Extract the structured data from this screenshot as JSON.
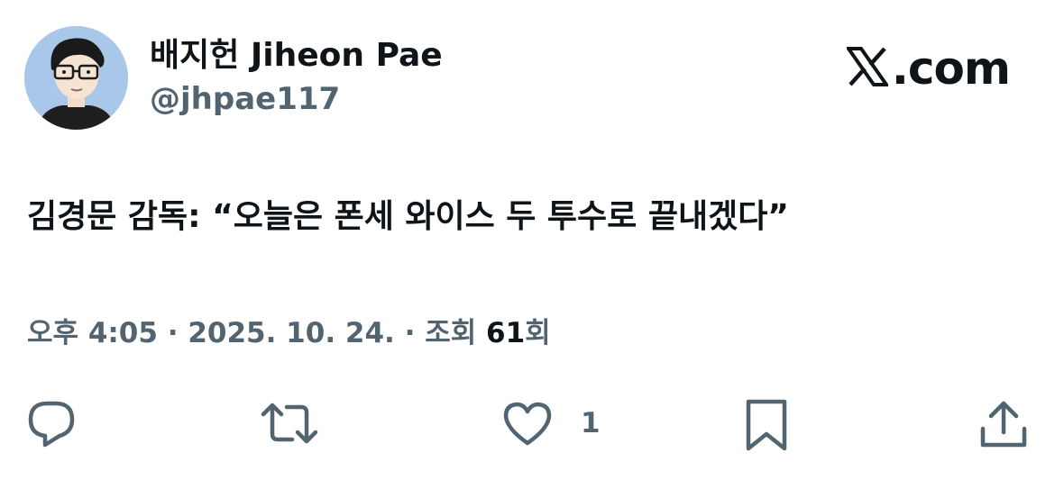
{
  "author": {
    "display_name": "배지헌 Jiheon Pae",
    "handle": "@jhpae117",
    "avatar_icon": "cartoon-avatar-with-glasses"
  },
  "brand": {
    "logo_icon": "x-logo-icon",
    "text": ".com"
  },
  "tweet": {
    "text": "김경문 감독: “오늘은 폰세 와이스 두 투수로 끝내겠다”"
  },
  "meta": {
    "time": "오후 4:05",
    "separator1": " · ",
    "date": "2025. 10. 24.",
    "separator2": " · ",
    "views_label": "조회 ",
    "views_count": "61",
    "views_suffix": "회"
  },
  "actions": {
    "reply_icon": "reply-icon",
    "retweet_icon": "retweet-icon",
    "like_icon": "heart-icon",
    "like_count": "1",
    "bookmark_icon": "bookmark-icon",
    "share_icon": "share-icon"
  },
  "colors": {
    "text_primary": "#0f1419",
    "text_secondary": "#536471",
    "avatar_bg": "#a9c7e8"
  }
}
